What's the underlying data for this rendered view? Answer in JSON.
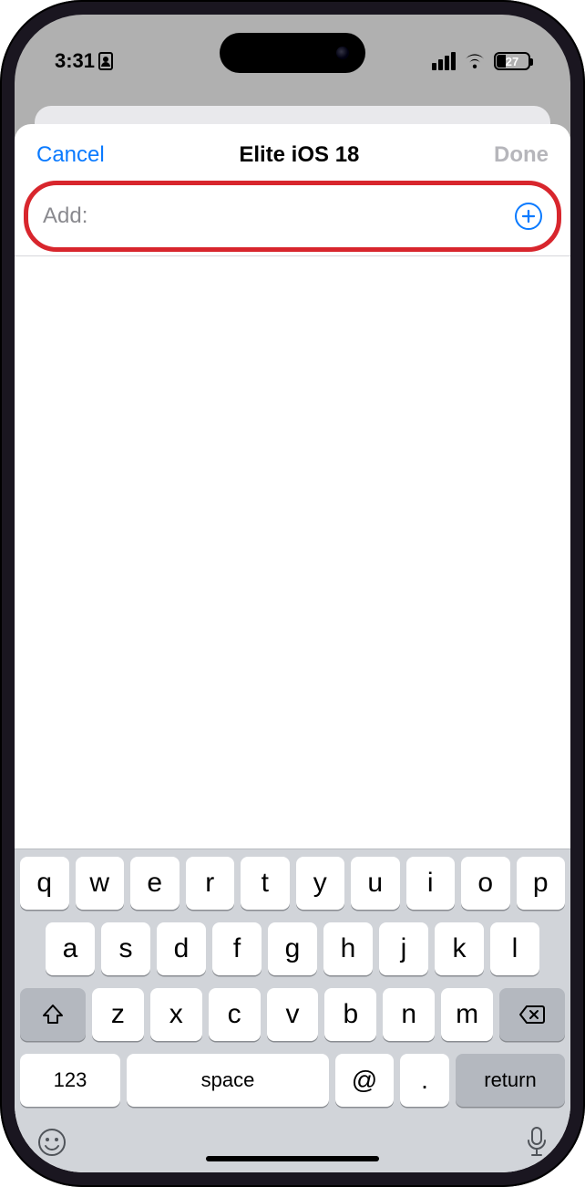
{
  "status": {
    "time": "3:31",
    "battery_pct": "27"
  },
  "sheet": {
    "cancel": "Cancel",
    "title": "Elite iOS 18",
    "done": "Done"
  },
  "add_row": {
    "label": "Add:"
  },
  "keyboard": {
    "row1": [
      "q",
      "w",
      "e",
      "r",
      "t",
      "y",
      "u",
      "i",
      "o",
      "p"
    ],
    "row2": [
      "a",
      "s",
      "d",
      "f",
      "g",
      "h",
      "j",
      "k",
      "l"
    ],
    "row3": [
      "z",
      "x",
      "c",
      "v",
      "b",
      "n",
      "m"
    ],
    "num": "123",
    "space": "space",
    "at": "@",
    "dot": ".",
    "return": "return"
  }
}
